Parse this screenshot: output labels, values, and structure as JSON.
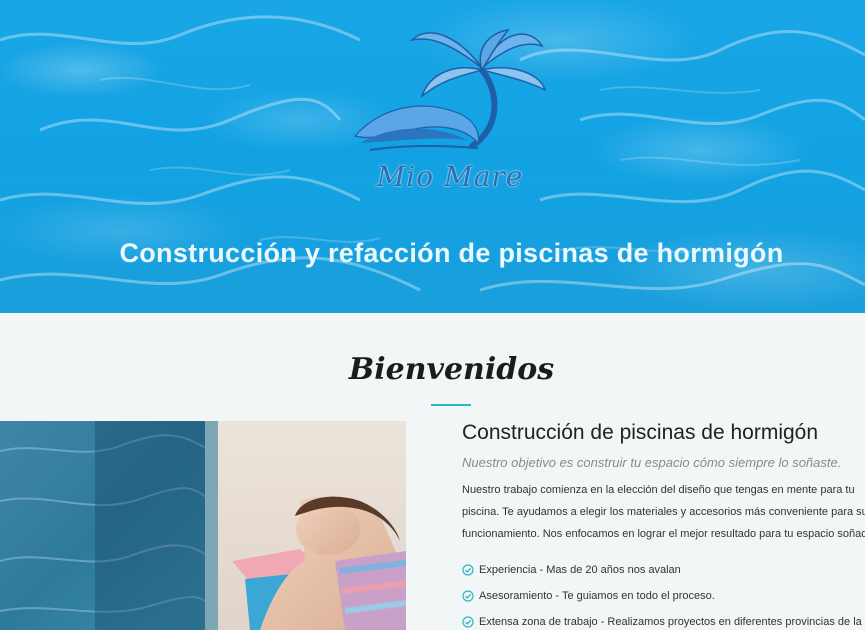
{
  "hero": {
    "brand": "Mio Mare",
    "title": "Construcción y refacción de piscinas de hormigón"
  },
  "welcome": {
    "heading": "Bienvenidos"
  },
  "content": {
    "title": "Construcción de piscinas de hormigón",
    "subtitle": "Nuestro objetivo es construir tu espacio cómo siempre lo soñaste.",
    "paragraph_lines": [
      "Nuestro trabajo comienza en la elección del diseño que tengas en mente para tu",
      "piscina. Te ayudamos a elegir los materiales y accesorios más conveniente para su",
      "funcionamiento. Nos enfocamos en lograr el mejor resultado para tu espacio soñado."
    ],
    "features": [
      "Experiencia - Mas de 20 años nos avalan",
      "Asesoramiento - Te guiamos en todo el proceso.",
      "Extensa zona de trabajo - Realizamos proyectos en diferentes provincias de la"
    ]
  },
  "colors": {
    "hero_blue": "#12a2e3",
    "accent": "#2ab8c4",
    "logo_blue": "#2b6fb0"
  }
}
